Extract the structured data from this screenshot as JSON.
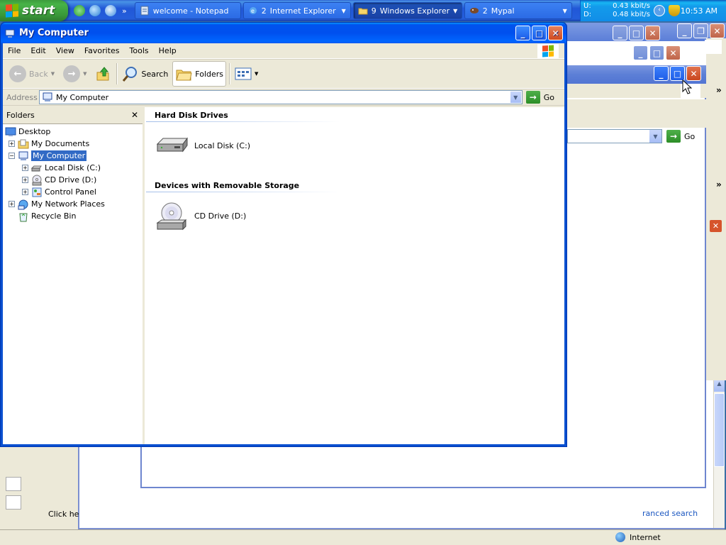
{
  "taskbar": {
    "start_label": "start",
    "quick_launch": [
      "utorrent-icon",
      "ie-icon",
      "ie-alt-icon"
    ],
    "chevron": "»",
    "tasks": [
      {
        "label": "welcome - Notepad",
        "icon": "notepad-icon",
        "active": false,
        "grouped": false
      },
      {
        "count": "2",
        "label": "Internet Explorer",
        "icon": "ie-icon",
        "active": false,
        "grouped": true
      },
      {
        "count": "9",
        "label": "Windows Explorer",
        "icon": "folder-icon",
        "active": true,
        "grouped": true
      },
      {
        "count": "2",
        "label": "Mypal",
        "icon": "mypal-icon",
        "active": false,
        "grouped": true
      }
    ],
    "tray": {
      "up_label": "U:",
      "up_value": "0.43 kbit/s",
      "down_label": "D:",
      "down_value": "0.48 kbit/s",
      "clock": "10:53 AM"
    }
  },
  "window": {
    "title": "My Computer",
    "menu": [
      "File",
      "Edit",
      "View",
      "Favorites",
      "Tools",
      "Help"
    ],
    "toolbar": {
      "back_label": "Back",
      "search_label": "Search",
      "folders_label": "Folders"
    },
    "address": {
      "label": "Address",
      "value": "My Computer",
      "go_label": "Go"
    },
    "folders_pane": {
      "title": "Folders",
      "tree": [
        {
          "label": "Desktop",
          "level": 0,
          "expander": "",
          "icon": "desktop-icon"
        },
        {
          "label": "My Documents",
          "level": 1,
          "expander": "+",
          "icon": "my-documents-icon"
        },
        {
          "label": "My Computer",
          "level": 1,
          "expander": "−",
          "icon": "my-computer-icon",
          "selected": true
        },
        {
          "label": "Local Disk (C:)",
          "level": 2,
          "expander": "+",
          "icon": "hard-disk-icon"
        },
        {
          "label": "CD Drive (D:)",
          "level": 2,
          "expander": "+",
          "icon": "cd-drive-icon"
        },
        {
          "label": "Control Panel",
          "level": 2,
          "expander": "+",
          "icon": "control-panel-icon"
        },
        {
          "label": "My Network Places",
          "level": 1,
          "expander": "+",
          "icon": "network-places-icon"
        },
        {
          "label": "Recycle Bin",
          "level": 1,
          "expander": "",
          "icon": "recycle-bin-icon"
        }
      ]
    },
    "groups": [
      {
        "heading": "Hard Disk Drives",
        "items": [
          {
            "label": "Local Disk (C:)",
            "icon": "hard-disk-icon"
          }
        ]
      },
      {
        "heading": "Devices with Removable Storage",
        "items": [
          {
            "label": "CD Drive (D:)",
            "icon": "cd-drive-icon"
          }
        ]
      }
    ]
  },
  "background": {
    "go_label": "Go",
    "status_zone": "Internet",
    "link_text": "ranced search",
    "partial_text": "Click he"
  },
  "colors": {
    "desktop": "#3a6ea5",
    "title_blue": "#0053ee",
    "selection": "#316ac5"
  }
}
